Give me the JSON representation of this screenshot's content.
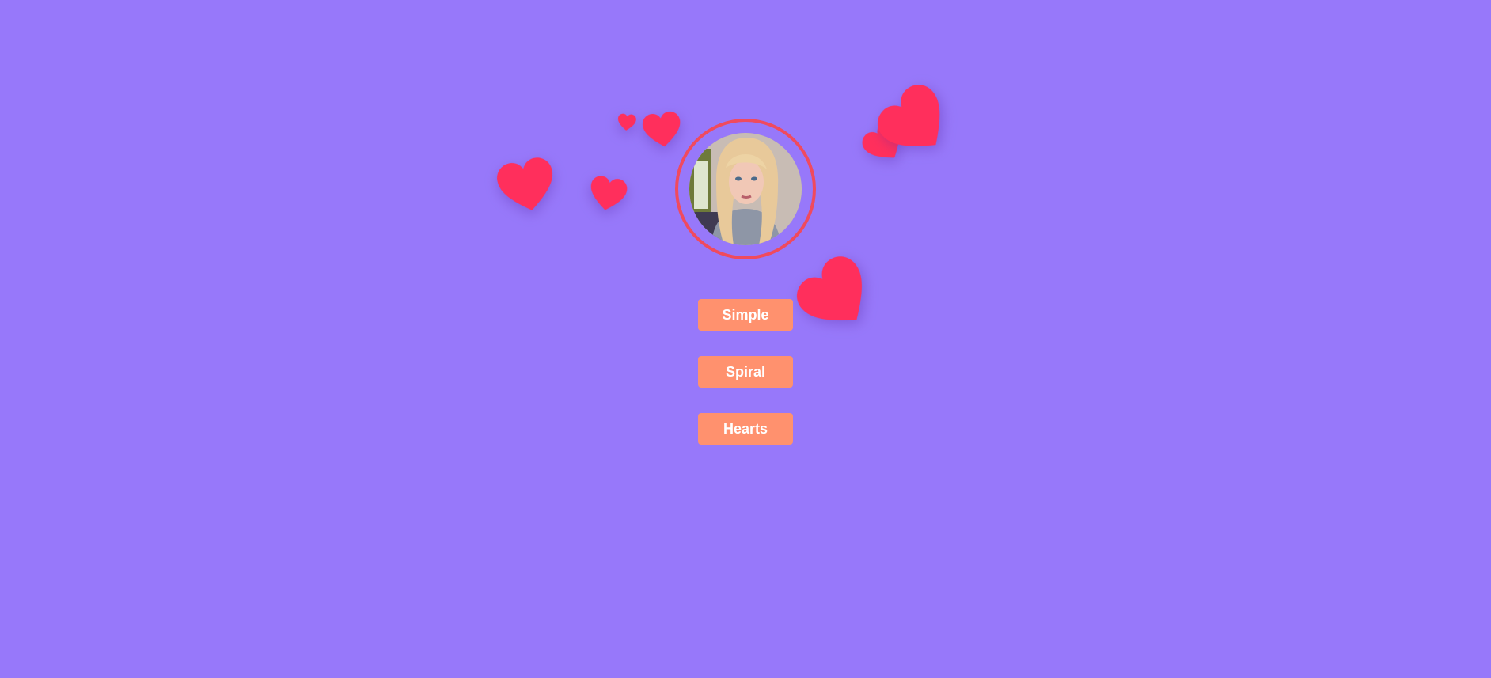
{
  "colors": {
    "background": "#9778fa",
    "button_bg": "#ff916e",
    "button_text": "#ffffff",
    "heart": "#ff2f5c",
    "ring": "#f04a5e"
  },
  "avatar": {
    "icon": "profile-photo"
  },
  "buttons": {
    "simple": "Simple",
    "spiral": "Spiral",
    "hearts": "Hearts"
  },
  "decorations": {
    "icon": "heart-icon"
  }
}
